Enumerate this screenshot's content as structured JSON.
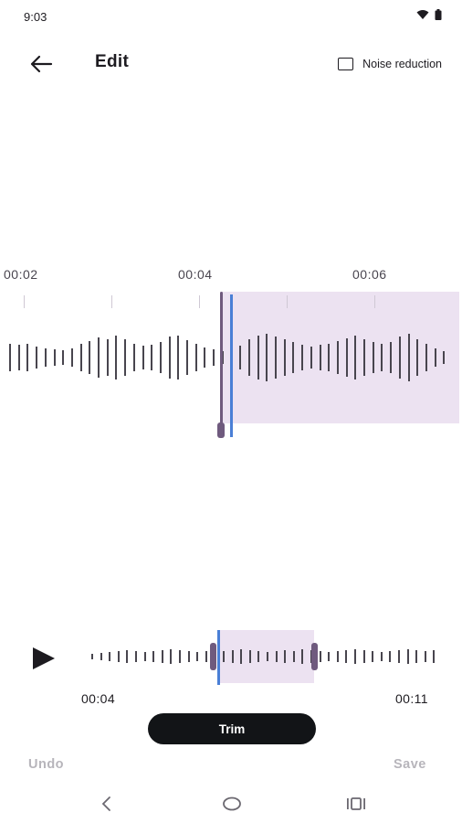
{
  "status": {
    "time": "9:03"
  },
  "header": {
    "title": "Edit",
    "noise_reduction_label": "Noise reduction"
  },
  "timeline": {
    "labels": [
      "00:02",
      "00:04",
      "00:06"
    ]
  },
  "mini": {
    "start_time": "00:04",
    "end_time": "00:11"
  },
  "actions": {
    "trim": "Trim",
    "undo": "Undo",
    "save": "Save"
  },
  "colors": {
    "selection": "#ece2f1",
    "handle": "#6f5a7e",
    "playhead": "#4a7fd6",
    "wave": "#48454e",
    "button": "#121417",
    "disabled": "#b7b5bb"
  },
  "icons": {
    "back": "arrow-back-icon",
    "play": "play-icon",
    "wifi": "wifi-icon",
    "battery": "battery-icon"
  }
}
